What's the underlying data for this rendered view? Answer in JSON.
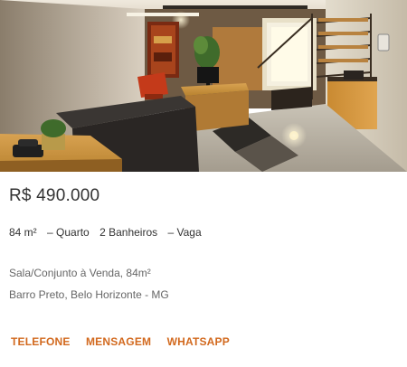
{
  "listing": {
    "image_alt": "office interior photo",
    "price": "R$ 490.000",
    "features": {
      "area": "84 m²",
      "quarto": "– Quarto",
      "banheiros": "2 Banheiros",
      "vaga": "– Vaga"
    },
    "type_line": "Sala/Conjunto à Venda, 84m²",
    "location_line": "Barro Preto, Belo Horizonte - MG"
  },
  "actions": {
    "telefone": "TELEFONE",
    "mensagem": "MENSAGEM",
    "whatsapp": "WHATSAPP"
  },
  "colors": {
    "accent": "#d2691e",
    "price_text": "#333333",
    "secondary_text": "#666666"
  }
}
